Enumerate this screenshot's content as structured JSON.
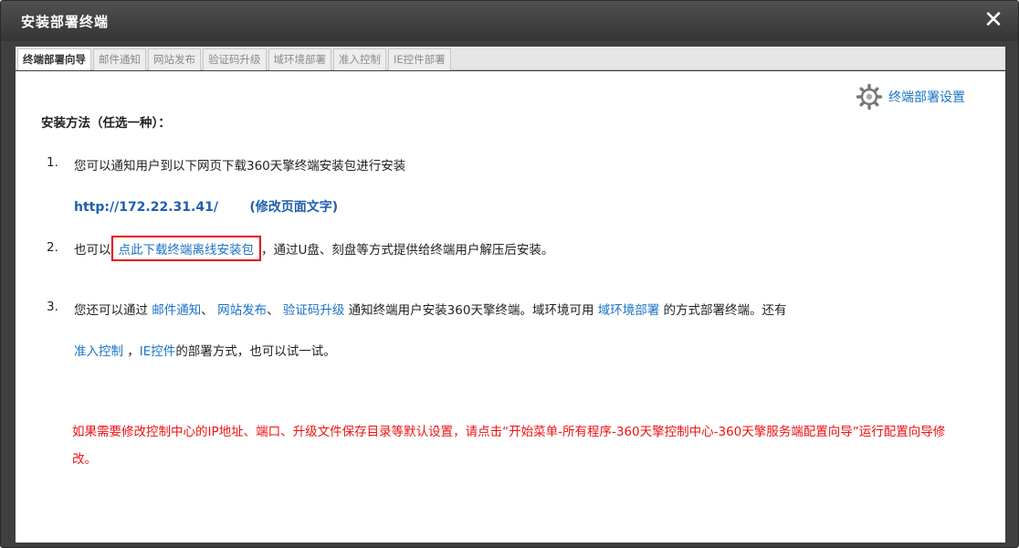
{
  "window": {
    "title": "安装部署终端",
    "close_label": "✕"
  },
  "tabs": [
    {
      "label": "终端部署向导",
      "active": true
    },
    {
      "label": "邮件通知",
      "active": false
    },
    {
      "label": "网站发布",
      "active": false
    },
    {
      "label": "验证码升级",
      "active": false
    },
    {
      "label": "域环境部署",
      "active": false
    },
    {
      "label": "准入控制",
      "active": false
    },
    {
      "label": "IE控件部署",
      "active": false
    }
  ],
  "settings": {
    "label": "终端部署设置",
    "icon": "gear-icon"
  },
  "content": {
    "heading": "安装方法（任选一种）：",
    "item1": {
      "number": "1.",
      "text": "您可以通知用户到以下网页下载360天擎终端安装包进行安装",
      "url": "http://172.22.31.41/",
      "edit_link": "(修改页面文字)"
    },
    "item2": {
      "number": "2.",
      "prefix": "也可以",
      "download_link": "点此下载终端离线安装包",
      "suffix": "，通过U盘、刻盘等方式提供给终端用户解压后安装。"
    },
    "item3": {
      "number": "3.",
      "prefix": "您还可以通过 ",
      "mail_link": "邮件通知",
      "sep1": "、 ",
      "site_link": "网站发布",
      "sep2": "、 ",
      "captcha_link": "验证码升级",
      "mid": " 通知终端用户安装360天擎终端。域环境可用 ",
      "domain_link": "域环境部署",
      "tail": " 的方式部署终端。还有",
      "access_link": "准入控制",
      "sep3": " ，",
      "ie_link": "IE控件",
      "end": "的部署方式，也可以试一试。"
    },
    "note": "如果需要修改控制中心的IP地址、端口、升级文件保存目录等默认设置，请点击“开始菜单-所有程序-360天擎控制中心-360天擎服务端配置向导”运行配置向导修改。"
  },
  "colors": {
    "link": "#1a73c8",
    "note": "#ee1111",
    "highlight_border": "#e60000",
    "titlebar": "#3f3f3f"
  }
}
